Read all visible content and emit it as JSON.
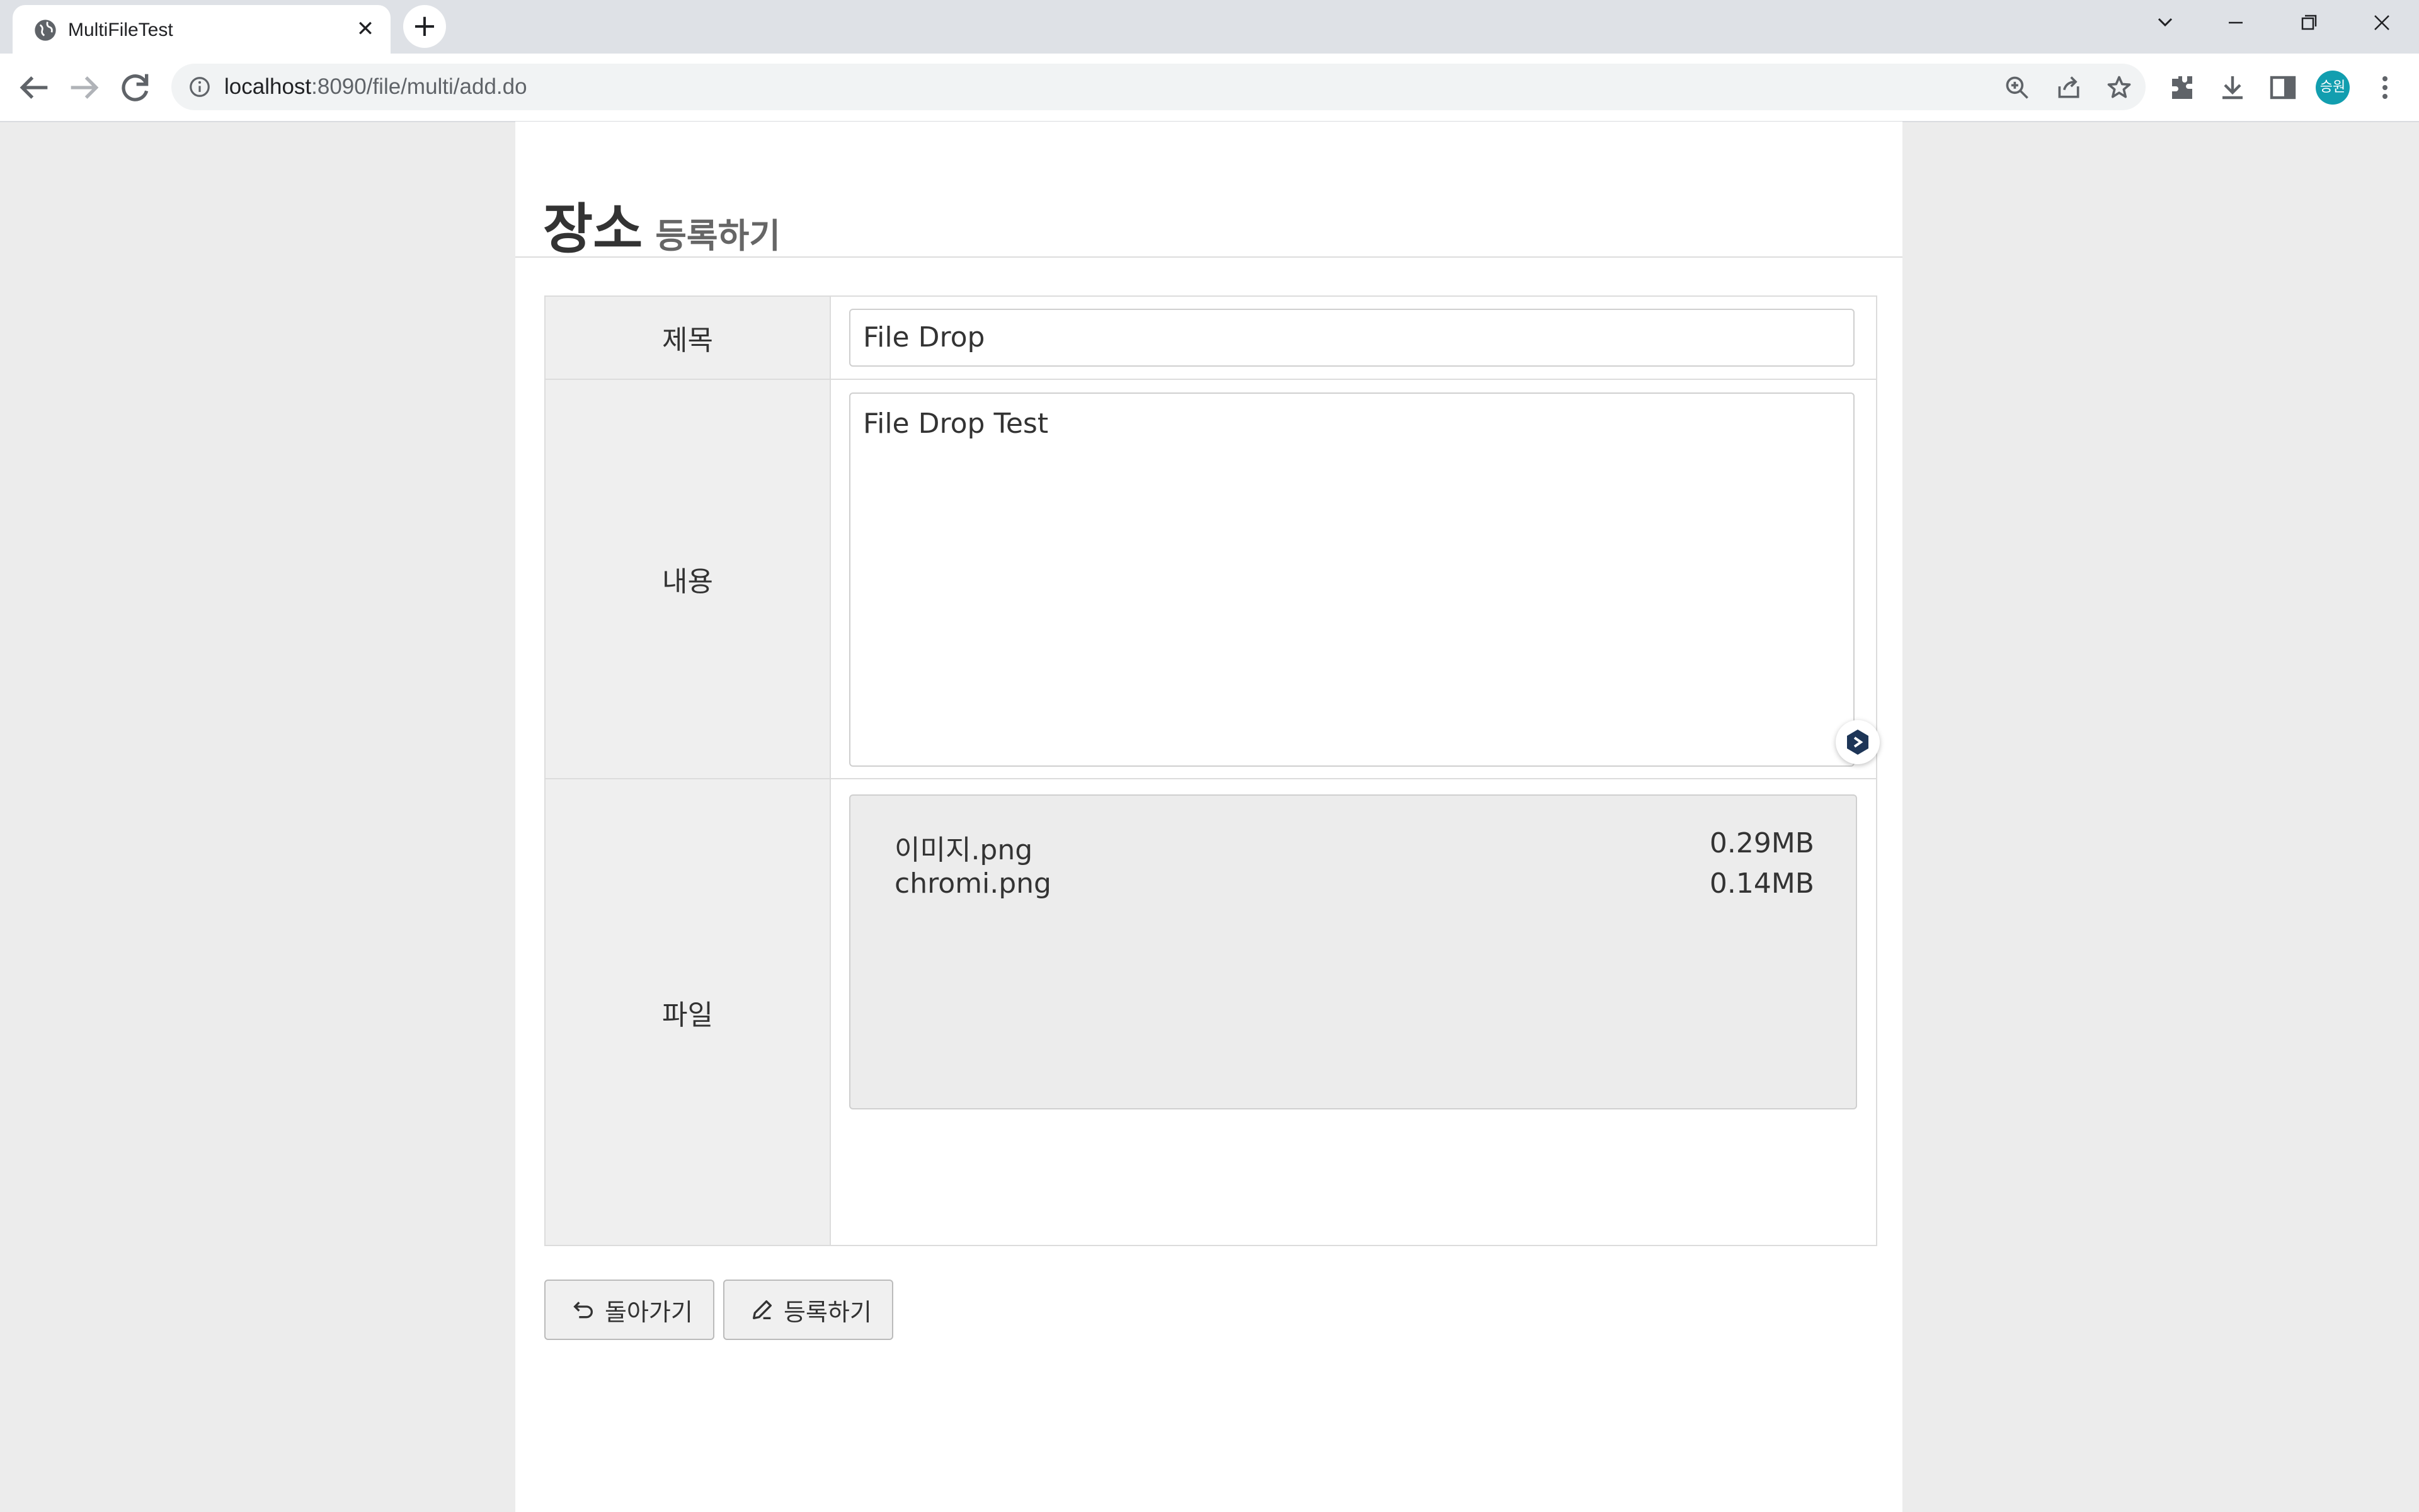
{
  "browser": {
    "tab_title": "MultiFileTest",
    "tab_close": "✕",
    "new_tab": "+",
    "url_host": "localhost",
    "url_path": ":8090/file/multi/add.do",
    "avatar_text": "승원"
  },
  "page": {
    "heading_main": "장소",
    "heading_sub": "등록하기"
  },
  "form": {
    "title_label": "제목",
    "title_value": "File Drop",
    "content_label": "내용",
    "content_value": "File Drop Test",
    "file_label": "파일",
    "files": [
      {
        "name": "이미지.png",
        "size": "0.29MB"
      },
      {
        "name": "chromi.png",
        "size": "0.14MB"
      }
    ]
  },
  "buttons": {
    "back_label": "돌아가기",
    "submit_label": "등록하기"
  }
}
